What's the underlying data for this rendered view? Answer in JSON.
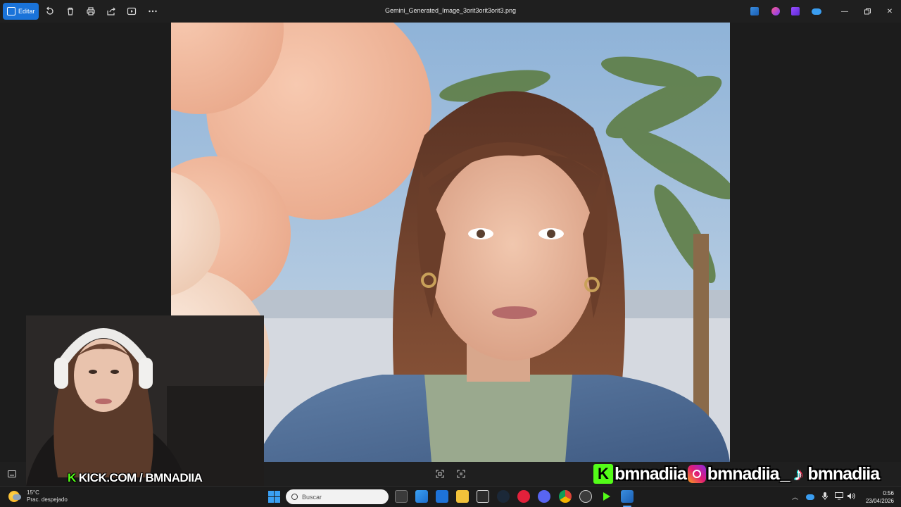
{
  "toolbar": {
    "edit_label": "Editar",
    "title": "Gemini_Generated_Image_3orit3orit3orit3.png",
    "icons": [
      "rotate-icon",
      "delete-icon",
      "print-icon",
      "share-icon",
      "slideshow-icon",
      "more-icon"
    ]
  },
  "window_controls": [
    "minimize",
    "restore",
    "close"
  ],
  "overlay": {
    "kick_banner": "KICK.COM / BMNADIIA",
    "kick_letter": "K",
    "socials": [
      {
        "platform": "kick",
        "handle": "bmnadiia"
      },
      {
        "platform": "instagram",
        "handle": "bmnadiia"
      },
      {
        "platform": "tiktok",
        "handle": "bmnadiia"
      }
    ],
    "socials_separator": "_"
  },
  "taskbar": {
    "weather": {
      "temp": "15°C",
      "desc": "Prac. despejado"
    },
    "search_placeholder": "Buscar",
    "clock": {
      "time": "0:56",
      "date": "23/04/2026"
    }
  },
  "colors": {
    "accent": "#1a73d9",
    "kick_green": "#53fc18",
    "background": "#202020"
  }
}
